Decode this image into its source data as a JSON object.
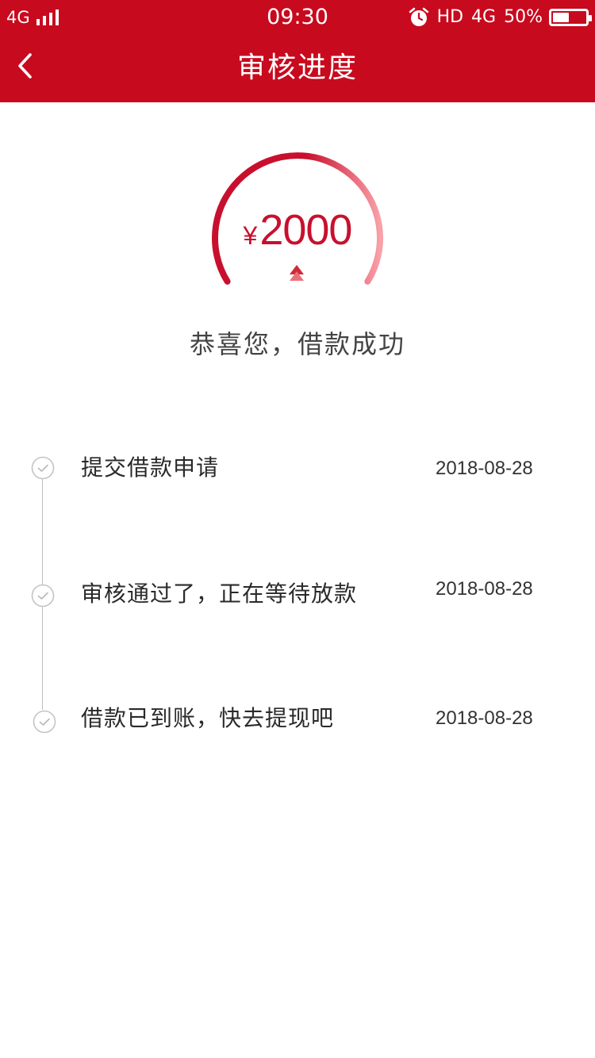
{
  "status_bar": {
    "network_left": "4G",
    "time": "09:30",
    "hd": "HD",
    "network_right": "4G",
    "battery_percent": "50%",
    "battery_level": 0.5
  },
  "nav": {
    "title": "审核进度",
    "back_icon": "chevron-left-icon"
  },
  "loan": {
    "currency": "¥",
    "amount": "2000",
    "message": "恭喜您，借款成功"
  },
  "colors": {
    "brand": "#c80a1e",
    "accent_text": "#c8102e",
    "gauge_start": "#c8102e",
    "gauge_end": "#f9a0a8"
  },
  "steps": [
    {
      "label": "提交借款申请",
      "date": "2018-08-28",
      "icon": "check-circle-icon"
    },
    {
      "label": "审核通过了，正在等待放款",
      "date": "2018-08-28",
      "icon": "check-circle-icon"
    },
    {
      "label": "借款已到账，快去提现吧",
      "date": "2018-08-28",
      "icon": "check-circle-icon"
    }
  ]
}
